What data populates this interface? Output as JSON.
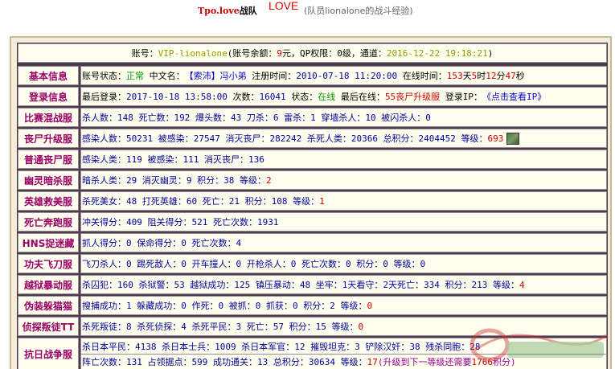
{
  "header": {
    "team_prefix": "Tpo.love",
    "team_suffix": "战队",
    "love": "LOVE",
    "subtitle": "(队员lionalone的战斗经验)"
  },
  "account": {
    "label": "账号：",
    "id": "VIP-lionalone",
    "balance_prefix": "(账号余额：",
    "balance": "9",
    "balance_unit": "元，QP权限：0级，通道：",
    "timestamp": "2016-12-22 19:18:21",
    "close": ")"
  },
  "rows": {
    "basic": {
      "label": "基本信息",
      "status_label": "账号状态：",
      "status": "正常",
      "cn_label": "中文名：",
      "cn_name": "【索沛】冯小弟",
      "reg_label": "注册时间：",
      "reg_time": "2010-07-18 11:20:00",
      "online_label": "在线时间：",
      "online_days": "153",
      "d": "天",
      "online_hours": "5",
      "h": "时",
      "online_mins": "12",
      "m": "分",
      "online_secs": "47",
      "s": "秒"
    },
    "login": {
      "label": "登录信息",
      "last_label": "最后登录：",
      "last_time": "2017-10-18 13:58:00",
      "count_label": "次数：",
      "count": "16041",
      "state_label": "状态：",
      "state": "在线",
      "last_at_label": "最后在线：",
      "last_at": "55丧尸升级服",
      "ip_label": "登录IP：",
      "ip_link": "《点击查看IP》"
    },
    "match": {
      "label": "比赛混战服",
      "text": "杀人数：148 死亡数：192 爆头数：43 刀杀：6 雷杀：1 穿墙杀人：10 被闪杀人：0"
    },
    "zombie_up": {
      "label": "丧尸升级服",
      "text_a": "感染人数：50231 被感染：27547 消灭丧尸：282242 杀死人类：20366 总积分：2404452 等级：",
      "level": "693"
    },
    "zombie": {
      "label": "普通丧尸服",
      "text": "感染人类：119 被感染：111 消灭丧尸：136"
    },
    "ghost": {
      "label": "幽灵暗杀服",
      "text_a": "暗杀人类：29 消灭幽灵：9 积分：38 等级：",
      "level": "2"
    },
    "hero": {
      "label": "英雄救美服",
      "text_a": "杀死美女：48 打死英雄：60 死亡：21 积分：108 等级：",
      "level": "1"
    },
    "death_run": {
      "label": "死亡奔跑服",
      "text": "冲关得分：409 阻关得分：521 死亡次数：1931"
    },
    "hns": {
      "label": "HNS捉迷藏",
      "text": "抓人得分：0 保命得分：0 死亡次数：4"
    },
    "kungfu": {
      "label": "功夫飞刀服",
      "text": "飞刀杀人：0 踢死敌人：0 开车撞人：0 开枪杀人：0 死亡次数：0 积分：0 等级：0"
    },
    "jailbreak": {
      "label": "越狱暴动服",
      "text_a": "杀囚犯：160 杀狱警：53 越狱成功：125 镇压暴动：48 坐牢：",
      "days1": "1天",
      "text_b": " 看守：",
      "days2": "2天",
      "text_c": " 死亡：334 积分：213 等级：",
      "level": "4"
    },
    "disguise": {
      "label": "伪装躲猫猫",
      "text_a": "搜捕成功：1 躲藏成功：0 作死：0 被抓：0 抓获：0 积分：2 等级：",
      "level": "0"
    },
    "scout": {
      "label": "侦探叛徒TT",
      "text_a": "杀死叛徒：8 杀死侦探：4 杀死平民：3 死亡：57 积分：15 等级：",
      "level": "0"
    },
    "war": {
      "label": "抗日战争服",
      "line1": "杀日本平民：4138 杀日本士兵：1009 杀日本军官：12 摧毁坦克：3 铲除汉奸：38 残杀同胞：28",
      "line2_a": "阵亡次数：131 占领据点：599 成功通关：13 总积分：30634 等级：",
      "level": "17",
      "line2_b": " (升级到下一等级还需要",
      "need": "1766",
      "line2_c": "积分)"
    }
  },
  "colors": {
    "label": "#990066",
    "value": "#000099",
    "green": "#009900",
    "red": "#cc0000",
    "frame_bg": "#f3ecd9",
    "cell_bg": "#fffff0"
  },
  "icons": {
    "avatar": "level-avatar-icon",
    "watermark": "site-watermark-logo"
  }
}
